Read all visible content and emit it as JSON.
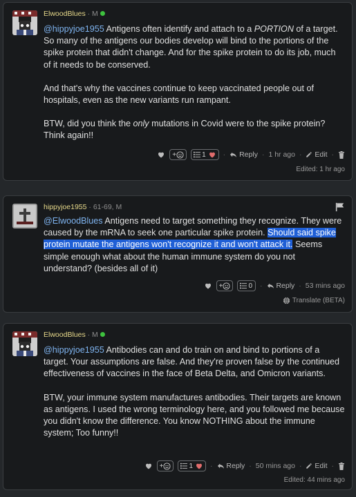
{
  "comments": [
    {
      "username": "ElwoodBlues",
      "meta": "· M",
      "mention": "@hippyjoe1955",
      "paragraphs": [
        {
          "before": " Antigens often identify and attach to a ",
          "em": "PORTION",
          "after": " of a target. So many of the antigens our bodies develop will bind to the portions of the spike protein that didn't change. And for the spike protein to do its job, much of it needs to be conserved."
        },
        {
          "text": "And that's why the vaccines continue to keep vaccinated people out of hospitals, even as the new variants run rampant."
        },
        {
          "before": "BTW, did you think the ",
          "em": "only",
          "after": " mutations in Covid were to the spike protein? Think again!!"
        }
      ],
      "reactions": {
        "add": "+",
        "count": "1"
      },
      "reply": "Reply",
      "time": "1 hr ago",
      "edit": "Edit",
      "edited": "Edited: 1 hr ago"
    },
    {
      "username": "hippyjoe1955",
      "meta": "· 61-69, M",
      "mention": "@ElwoodBlues",
      "text_before": " Antigens need to target something they recognize. They were caused by the mRNA to seek one particular spike protein. ",
      "highlight": "Should said spike protein mutate the antigens won't recognize it and won't attack it.",
      "text_after": " Seems simple enough what about the human immune system do you not understand? (besides all of it)",
      "reactions": {
        "add": "+",
        "count": "0"
      },
      "reply": "Reply",
      "time": "53 mins ago",
      "translate": "Translate (BETA)"
    },
    {
      "username": "ElwoodBlues",
      "meta": "· M",
      "mention": "@hippyjoe1955",
      "paragraphs": [
        {
          "text": " Antibodies can and do train on and bind to portions of a target. Your assumptions are false. And they're proven false by the continued effectiveness of vaccines in the face of Beta Delta, and Omicron variants."
        },
        {
          "text": "BTW, your immune system manufactures antibodies. Their targets are known as antigens. I used the wrong terminology here, and you followed me because you didn't know the difference. You know NOTHING about the immune system; Too funny!!"
        }
      ],
      "reactions": {
        "add": "+",
        "count": "1"
      },
      "reply": "Reply",
      "time": "50 mins ago",
      "edit": "Edit",
      "edited": "Edited: 44 mins ago"
    }
  ]
}
